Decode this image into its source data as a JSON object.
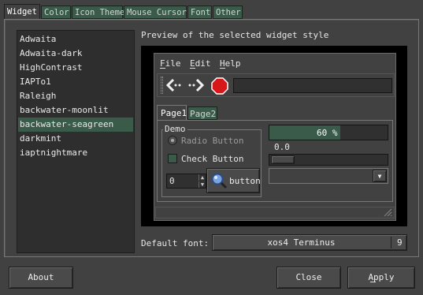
{
  "tabs": [
    "Widget",
    "Color",
    "Icon Theme",
    "Mouse Cursor",
    "Font",
    "Other"
  ],
  "themes": [
    "Adwaita",
    "Adwaita-dark",
    "HighContrast",
    "IAPTo1",
    "Raleigh",
    "backwater-moonlit",
    "backwater-seagreen",
    "darkmint",
    "iaptnightmare"
  ],
  "selected_theme": "backwater-seagreen",
  "preview": {
    "title": "Preview of the selected widget style",
    "menu": [
      "File",
      "Edit",
      "Help"
    ],
    "inner_tabs": [
      "Page1",
      "Page2"
    ],
    "demo_label": "Demo",
    "radio_label": "Radio Button",
    "check_label": "Check Button",
    "spin_value": "0",
    "button_label": "button",
    "progress_text": "60 %",
    "progress_fraction": 0.6,
    "scale_value": "0.0"
  },
  "font": {
    "label": "Default font:",
    "name": "xos4 Terminus",
    "size": "9"
  },
  "buttons": {
    "about": "About",
    "close": "Close",
    "apply": "Apply"
  }
}
